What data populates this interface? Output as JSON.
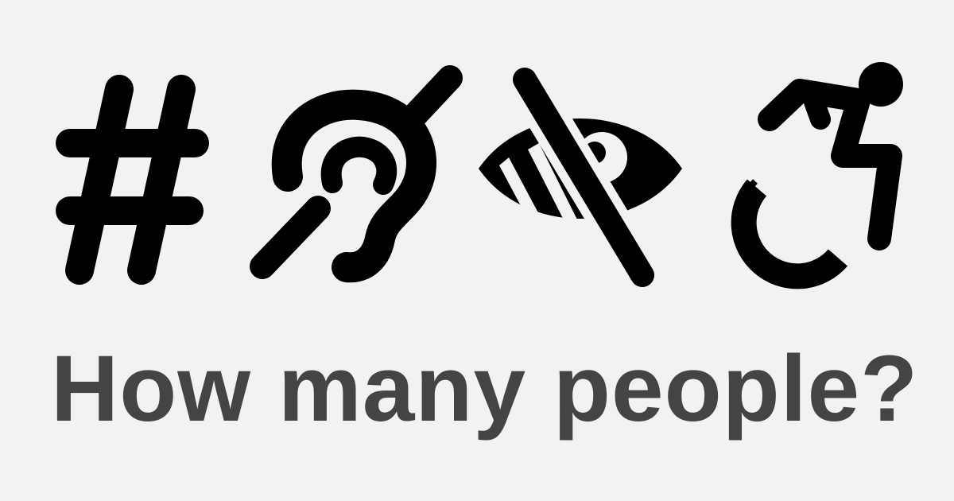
{
  "headline": "How many people?",
  "icons": [
    "hashtag-icon",
    "hearing-impaired-icon",
    "eye-slash-icon",
    "wheelchair-icon"
  ],
  "colors": {
    "background": "#f2f2f2",
    "icon": "#000000",
    "headline": "#444444"
  }
}
